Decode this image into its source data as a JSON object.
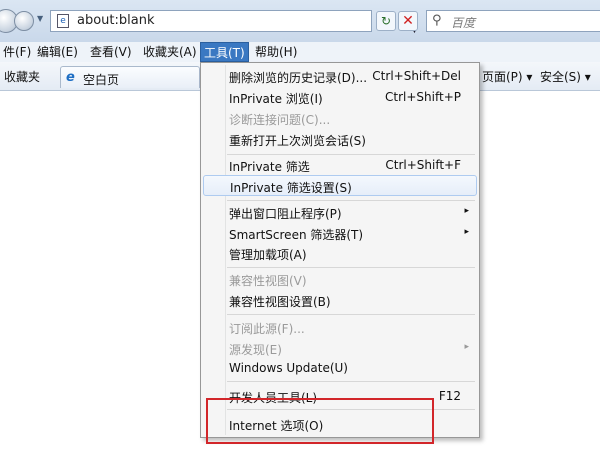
{
  "address_bar": {
    "url": "about:blank",
    "search_placeholder": "百度",
    "page_icon": "e",
    "refresh_glyph": "↻",
    "stop_glyph": "✕",
    "search_glyph": "⚲"
  },
  "menu_bar": {
    "items": [
      "件(F)",
      "编辑(E)",
      "查看(V)",
      "收藏夹(A)",
      "工具(T)",
      "帮助(H)"
    ],
    "active": "工具(T)"
  },
  "favorites_bar": {
    "label": "收藏夹",
    "tab_icon": "e",
    "tab_label": "空白页",
    "page_menu": "页面(P) ▾",
    "safety_menu": "安全(S) ▾"
  },
  "tools_menu": {
    "items": [
      {
        "label": "删除浏览的历史记录(D)...",
        "shortcut": "Ctrl+Shift+Del"
      },
      {
        "label": "InPrivate 浏览(I)",
        "shortcut": "Ctrl+Shift+P"
      },
      {
        "label": "诊断连接问题(C)...",
        "disabled": true
      },
      {
        "label": "重新打开上次浏览会话(S)"
      },
      {
        "label": "InPrivate 筛选",
        "shortcut": "Ctrl+Shift+F"
      },
      {
        "label": "InPrivate 筛选设置(S)",
        "hover": true
      },
      {
        "label": "弹出窗口阻止程序(P)",
        "submenu": true
      },
      {
        "label": "SmartScreen 筛选器(T)",
        "submenu": true
      },
      {
        "label": "管理加载项(A)"
      },
      {
        "label": "兼容性视图(V)",
        "disabled": true
      },
      {
        "label": "兼容性视图设置(B)"
      },
      {
        "label": "订阅此源(F)...",
        "disabled": true
      },
      {
        "label": "源发现(E)",
        "disabled": true,
        "submenu": true
      },
      {
        "label": "Windows Update(U)"
      },
      {
        "label": "开发人员工具(L)",
        "shortcut": "F12"
      },
      {
        "label": "Internet 选项(O)"
      }
    ],
    "arrow_glyph": "▸"
  },
  "colors": {
    "highlight_box": "#d2262a",
    "active_menu": "#3a78c2"
  }
}
